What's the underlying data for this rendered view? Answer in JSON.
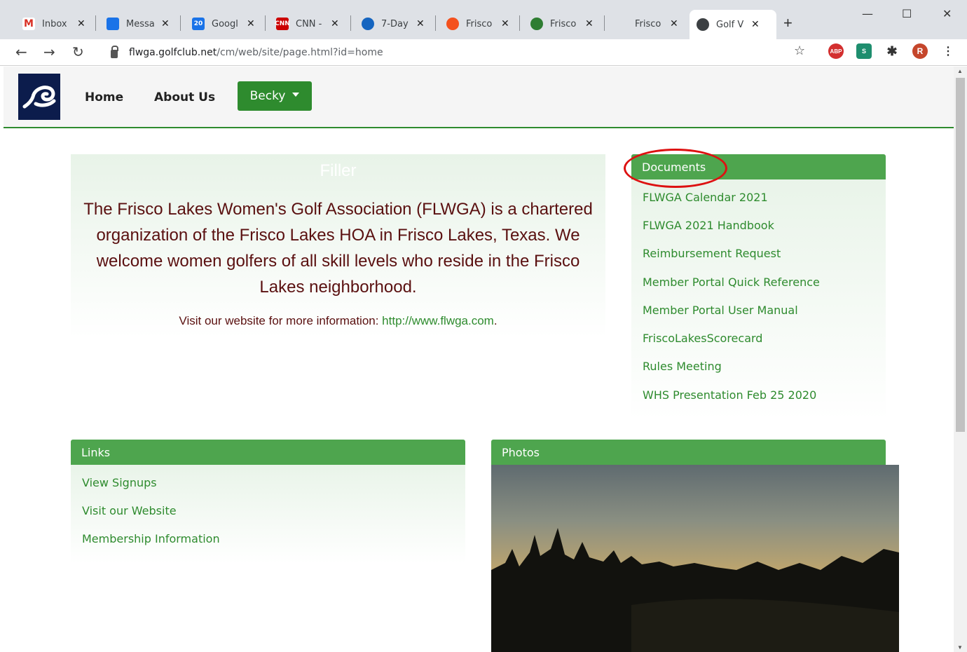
{
  "browser": {
    "tabs": [
      {
        "label": "Inbox",
        "icon": "gmail-icon",
        "color": "#d93025"
      },
      {
        "label": "Messa",
        "icon": "messages-icon",
        "color": "#1a73e8"
      },
      {
        "label": "Googl",
        "icon": "calendar-icon",
        "color": "#1a73e8"
      },
      {
        "label": "CNN -",
        "icon": "cnn-icon",
        "color": "#cc0000"
      },
      {
        "label": "7-Day",
        "icon": "weather-icon",
        "color": "#1565c0"
      },
      {
        "label": "Frisco",
        "icon": "sun-icon",
        "color": "#f4511e"
      },
      {
        "label": "Frisco",
        "icon": "golf-icon",
        "color": "#2e7d32"
      },
      {
        "label": "Frisco",
        "icon": "",
        "color": ""
      },
      {
        "label": "Golf V",
        "icon": "globe-icon",
        "color": "#3c4043"
      }
    ],
    "window_controls": {
      "minimize": "—",
      "maximize": "☐",
      "close": "✕"
    },
    "url_host": "flwga.golfclub.net",
    "url_path": "/cm/web/site/page.html?id=home",
    "profile_initial": "R"
  },
  "site": {
    "nav": {
      "home": "Home",
      "about": "About Us",
      "user": "Becky"
    },
    "intro": {
      "title": "Filler",
      "text": "The Frisco Lakes Women's Golf Association (FLWGA) is a chartered organization of the Frisco Lakes HOA in Frisco Lakes, Texas. We welcome women golfers of all skill levels who reside in the Frisco Lakes neighborhood.",
      "visit_prefix": "Visit our website for more information: ",
      "visit_link": "http://www.flwga.com",
      "visit_suffix": "."
    },
    "documents": {
      "title": "Documents",
      "items": [
        "FLWGA Calendar 2021",
        "FLWGA 2021 Handbook",
        "Reimbursement Request",
        "Member Portal Quick Reference",
        "Member Portal User Manual",
        "FriscoLakesScorecard",
        "Rules Meeting",
        "WHS Presentation Feb 25 2020"
      ]
    },
    "links": {
      "title": "Links",
      "items": [
        "View Signups",
        "Visit our Website",
        "Membership Information"
      ]
    },
    "photos": {
      "title": "Photos"
    },
    "accent_color": "#4ea54e",
    "annotation_color": "#dd1111"
  }
}
